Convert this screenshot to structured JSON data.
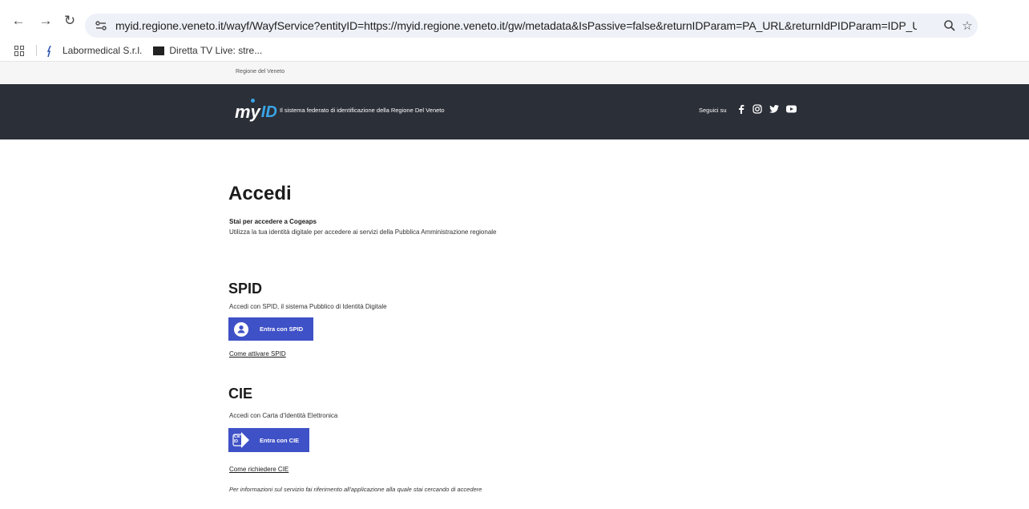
{
  "browser": {
    "url": "myid.regione.veneto.it/wayf/WayfService?entityID=https://myid.regione.veneto.it/gw/metadata&IsPassive=false&returnIDParam=PA_URL&returnIdPIDParam=IDP_URL&authorityRegistryMetadata...",
    "bookmarks": [
      {
        "label": "Labormedical S.r.l."
      },
      {
        "label": "Diretta TV Live: stre..."
      }
    ]
  },
  "page": {
    "region_label": "Regione del Veneto",
    "header": {
      "logo_my": "my",
      "logo_id": "ID",
      "tagline": "Il sistema federato di identificazione della Regione Del Veneto",
      "follow_label": "Seguici su"
    },
    "title": "Accedi",
    "lead_strong": "Stai per accedere a Cogeaps",
    "lead": "Utilizza la tua identità digitale per accedere ai servizi della Pubblica Amministrazione regionale",
    "spid": {
      "heading": "SPID",
      "description": "Accedi con SPID, il sistema Pubblico di Identità Digitale",
      "button_label": "Entra con SPID",
      "link_label": "Come attivare SPID"
    },
    "cie": {
      "heading": "CIE",
      "description": "Accedi con Carta d'Identità Elettronica",
      "button_label": "Entra con CIE",
      "icon_text": "Cie ID",
      "link_label": "Come richiedere CIE"
    },
    "note": "Per informazioni sul servizio fai riferimento all'applicazione alla quale stai cercando di accedere"
  },
  "colors": {
    "header_bg": "#2b2f38",
    "button_bg": "#3f51c7",
    "logo_accent": "#3aa6e8"
  }
}
